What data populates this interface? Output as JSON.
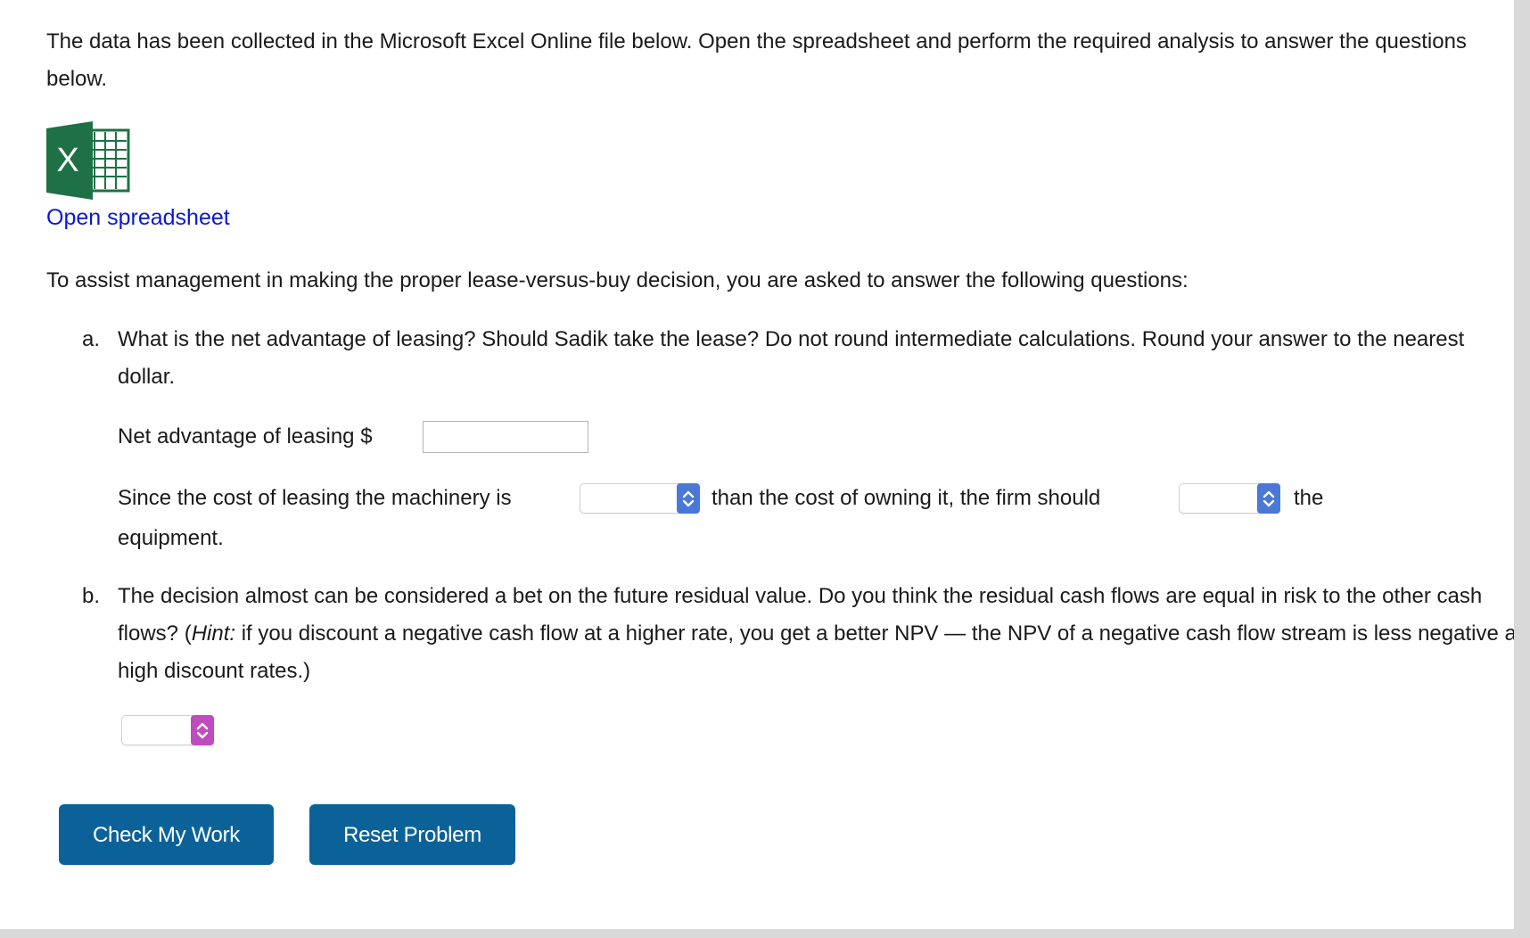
{
  "intro": {
    "text": "The data has been collected in the Microsoft Excel Online file below. Open the spreadsheet and perform the required analysis to answer the questions below."
  },
  "excel_icon": {
    "name": "excel-icon",
    "letter": "X",
    "color": "#1e7145"
  },
  "open_link": {
    "label": "Open spreadsheet",
    "color": "#0a18d6"
  },
  "assist_text": "To assist management in making the proper lease-versus-buy decision, you are asked to answer the following questions:",
  "question_a": {
    "letter": "a.",
    "text": "What is the net advantage of leasing? Should Sadik take the lease? Do not round intermediate calculations. Round your answer to the nearest dollar.",
    "net_label": "Net advantage of leasing $",
    "net_value": "",
    "since_part1": "Since the cost of leasing the machinery is",
    "select1_value": "",
    "since_part2": "than the cost of owning it, the firm should",
    "select2_value": "",
    "since_part3": "the",
    "since_part4": "equipment."
  },
  "question_b": {
    "letter": "b.",
    "text_before_hint": "The decision almost can be considered a bet on the future residual value. Do you think the residual cash flows are equal in risk to the other cash flows? (",
    "hint_label": "Hint:",
    "text_after_hint": " if you discount a negative cash flow at a higher rate, you get a better NPV — the NPV of a negative cash flow stream is less negative at high discount rates.)",
    "select_value": ""
  },
  "select_colors": {
    "blue_arrow": "#4a78d6",
    "pink_arrow": "#c04bbf"
  },
  "buttons": {
    "check_label": "Check My Work",
    "reset_label": "Reset Problem",
    "color": "#0b6298"
  }
}
